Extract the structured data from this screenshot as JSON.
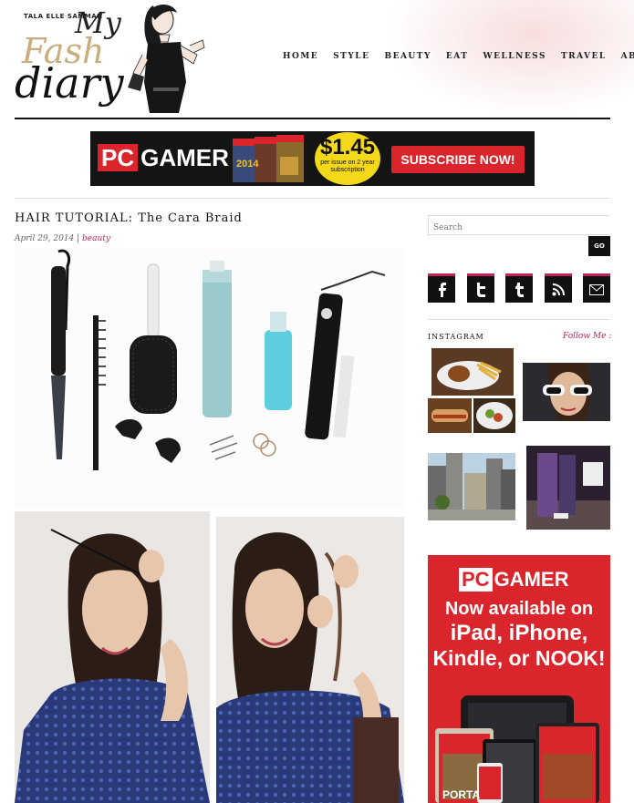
{
  "site": {
    "author": "TALA ELLE SAMMAN",
    "logo_word1": "My",
    "logo_word2": "Fash",
    "logo_word3": "diary"
  },
  "nav": {
    "items": [
      "HOME",
      "STYLE",
      "BEAUTY",
      "EAT",
      "WELLNESS",
      "TRAVEL",
      "ABOUT"
    ]
  },
  "banner": {
    "pc": "PC",
    "gamer": "GAMER",
    "price": "$1.45",
    "price_note": "per issue on 2 year subscription",
    "cta": "SUBSCRIBE NOW!",
    "mag_year": "2014"
  },
  "post": {
    "title": "HAIR TUTORIAL: The Cara Braid",
    "date": "April 29, 2014",
    "separator": " | ",
    "category": "beauty"
  },
  "sidebar": {
    "search_placeholder": "Search",
    "go_label": "GO",
    "social_icons": [
      "facebook-icon",
      "twitter-icon",
      "tumblr-icon",
      "rss-icon",
      "email-icon"
    ],
    "instagram_label": "INSTAGRAM",
    "follow_label": "Follow Me :"
  },
  "ad": {
    "pc": "PC",
    "gamer": "GAMER",
    "line1": "Now available on",
    "line2": "iPad, iPhone,",
    "line3": "Kindle, or NOOK!",
    "mag_word": "PORTA"
  },
  "colors": {
    "accent": "#c0245a",
    "brand_red": "#d9252b",
    "logo_gold": "#c8ad7d",
    "price_yellow": "#f4d81a"
  }
}
